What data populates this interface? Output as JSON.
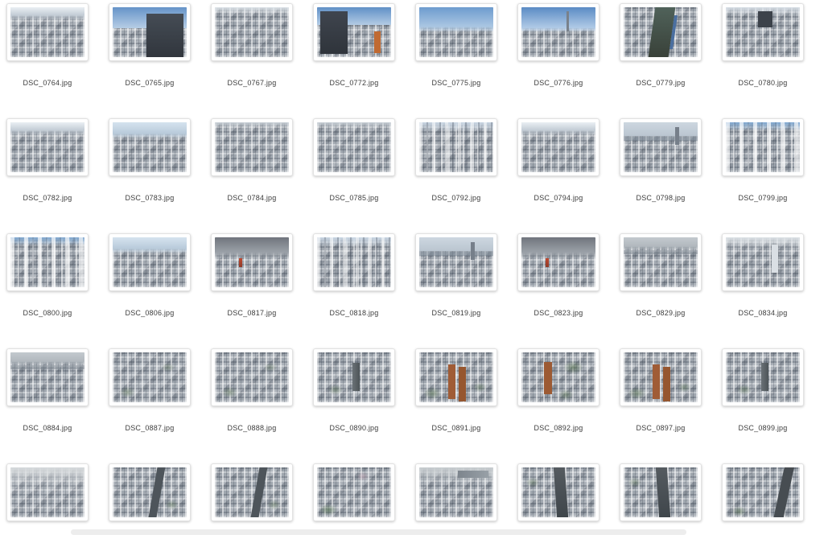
{
  "page": {
    "background_color": "#ffffff"
  },
  "gallery": {
    "items": [
      {
        "filename": "DSC_0764.jpg",
        "variant": "hazy-skyline"
      },
      {
        "filename": "DSC_0765.jpg",
        "variant": "dark-tower-blue-sky"
      },
      {
        "filename": "DSC_0767.jpg",
        "variant": "dense-gray-city"
      },
      {
        "filename": "DSC_0772.jpg",
        "variant": "construction-cranes-blue-sky"
      },
      {
        "filename": "DSC_0775.jpg",
        "variant": "blue-sky-cityscape"
      },
      {
        "filename": "DSC_0776.jpg",
        "variant": "skytree-blue-sky"
      },
      {
        "filename": "DSC_0779.jpg",
        "variant": "street-canyon"
      },
      {
        "filename": "DSC_0780.jpg",
        "variant": "dense-city-dark-tower"
      },
      {
        "filename": "DSC_0782.jpg",
        "variant": "hazy-skyline"
      },
      {
        "filename": "DSC_0783.jpg",
        "variant": "hazy-blue-city"
      },
      {
        "filename": "DSC_0784.jpg",
        "variant": "dense-dark-city"
      },
      {
        "filename": "DSC_0785.jpg",
        "variant": "dense-dark-city"
      },
      {
        "filename": "DSC_0792.jpg",
        "variant": "vertical-towers"
      },
      {
        "filename": "DSC_0794.jpg",
        "variant": "hazy-skyline"
      },
      {
        "filename": "DSC_0798.jpg",
        "variant": "horizon-tower"
      },
      {
        "filename": "DSC_0799.jpg",
        "variant": "white-towers-blue-sliver"
      },
      {
        "filename": "DSC_0800.jpg",
        "variant": "white-towers-blue-sliver"
      },
      {
        "filename": "DSC_0806.jpg",
        "variant": "hazy-blue-city"
      },
      {
        "filename": "DSC_0817.jpg",
        "variant": "cloudy-brown-city-red-tower"
      },
      {
        "filename": "DSC_0818.jpg",
        "variant": "vertical-towers"
      },
      {
        "filename": "DSC_0819.jpg",
        "variant": "horizon-tower"
      },
      {
        "filename": "DSC_0823.jpg",
        "variant": "cloudy-brown-city-red-tower"
      },
      {
        "filename": "DSC_0829.jpg",
        "variant": "gray-horizon-city"
      },
      {
        "filename": "DSC_0834.jpg",
        "variant": "hazy-white-tower"
      },
      {
        "filename": "DSC_0884.jpg",
        "variant": "gray-horizon-city"
      },
      {
        "filename": "DSC_0887.jpg",
        "variant": "aerial-dense"
      },
      {
        "filename": "DSC_0888.jpg",
        "variant": "aerial-dense"
      },
      {
        "filename": "DSC_0890.jpg",
        "variant": "aerial-dense-tower"
      },
      {
        "filename": "DSC_0891.jpg",
        "variant": "aerial-orange-towers"
      },
      {
        "filename": "DSC_0892.jpg",
        "variant": "aerial-orange-tower-green"
      },
      {
        "filename": "DSC_0897.jpg",
        "variant": "aerial-orange-towers"
      },
      {
        "filename": "DSC_0899.jpg",
        "variant": "aerial-dense-tower"
      },
      {
        "filename": "",
        "variant": "aerial-wide-haze"
      },
      {
        "filename": "",
        "variant": "aerial-road"
      },
      {
        "filename": "",
        "variant": "aerial-road"
      },
      {
        "filename": "",
        "variant": "aerial-green-blocks"
      },
      {
        "filename": "",
        "variant": "aerial-wide-haze-skyline"
      },
      {
        "filename": "",
        "variant": "aerial-highway"
      },
      {
        "filename": "",
        "variant": "aerial-highway"
      },
      {
        "filename": "",
        "variant": "aerial-diagonal-road"
      }
    ]
  },
  "scrollbar": {
    "orientation": "horizontal",
    "color": "#ededed"
  }
}
